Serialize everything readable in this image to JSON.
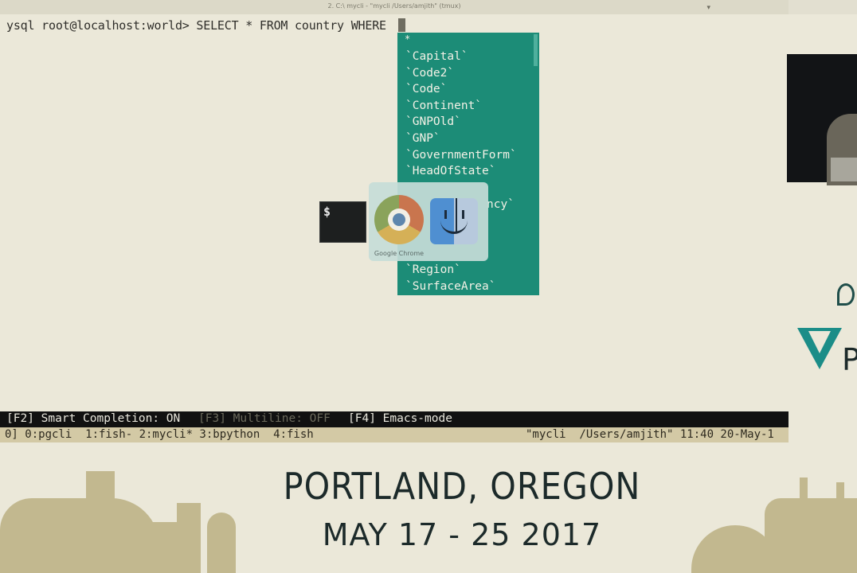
{
  "window": {
    "title": "2. C:\\ mycli - \"mycli /Users/amjith\" (tmux)"
  },
  "terminal": {
    "prompt": "ysql root@localhost:world> SELECT * FROM country WHERE"
  },
  "completion_menu": {
    "first": "*",
    "items": [
      "`Capital`",
      "`Code2`",
      "`Code`",
      "`Continent`",
      "`GNPOld`",
      "`GNP`",
      "`GovernmentForm`",
      "`HeadOfState`",
      "",
      "ncy`",
      "",
      "",
      "",
      "`Region`",
      "`SurfaceArea`"
    ]
  },
  "app_switcher": {
    "terminal_glyph": "$",
    "chrome_label": "Google Chrome"
  },
  "status_bar": {
    "f2": "[F2] Smart Completion: ON",
    "f3": "[F3] Multiline: OFF",
    "f4": "[F4] Emacs-mode"
  },
  "tmux_bar": {
    "windows": "0] 0:pgcli  1:fish- 2:mycli* 3:bpython  4:fish",
    "right": "\"mycli  /Users/amjith\" 11:40 20-May-1"
  },
  "event": {
    "city": "PORTLAND, OREGON",
    "dates": "MAY 17 - 25 2017",
    "logo_letter": "P"
  },
  "colors": {
    "terminal_bg": "#ebe8d9",
    "completion_bg": "#1c8c77",
    "status_bg": "#111111",
    "tmux_bg": "#d3c9a5",
    "dim_text": "#6b6a5c"
  }
}
